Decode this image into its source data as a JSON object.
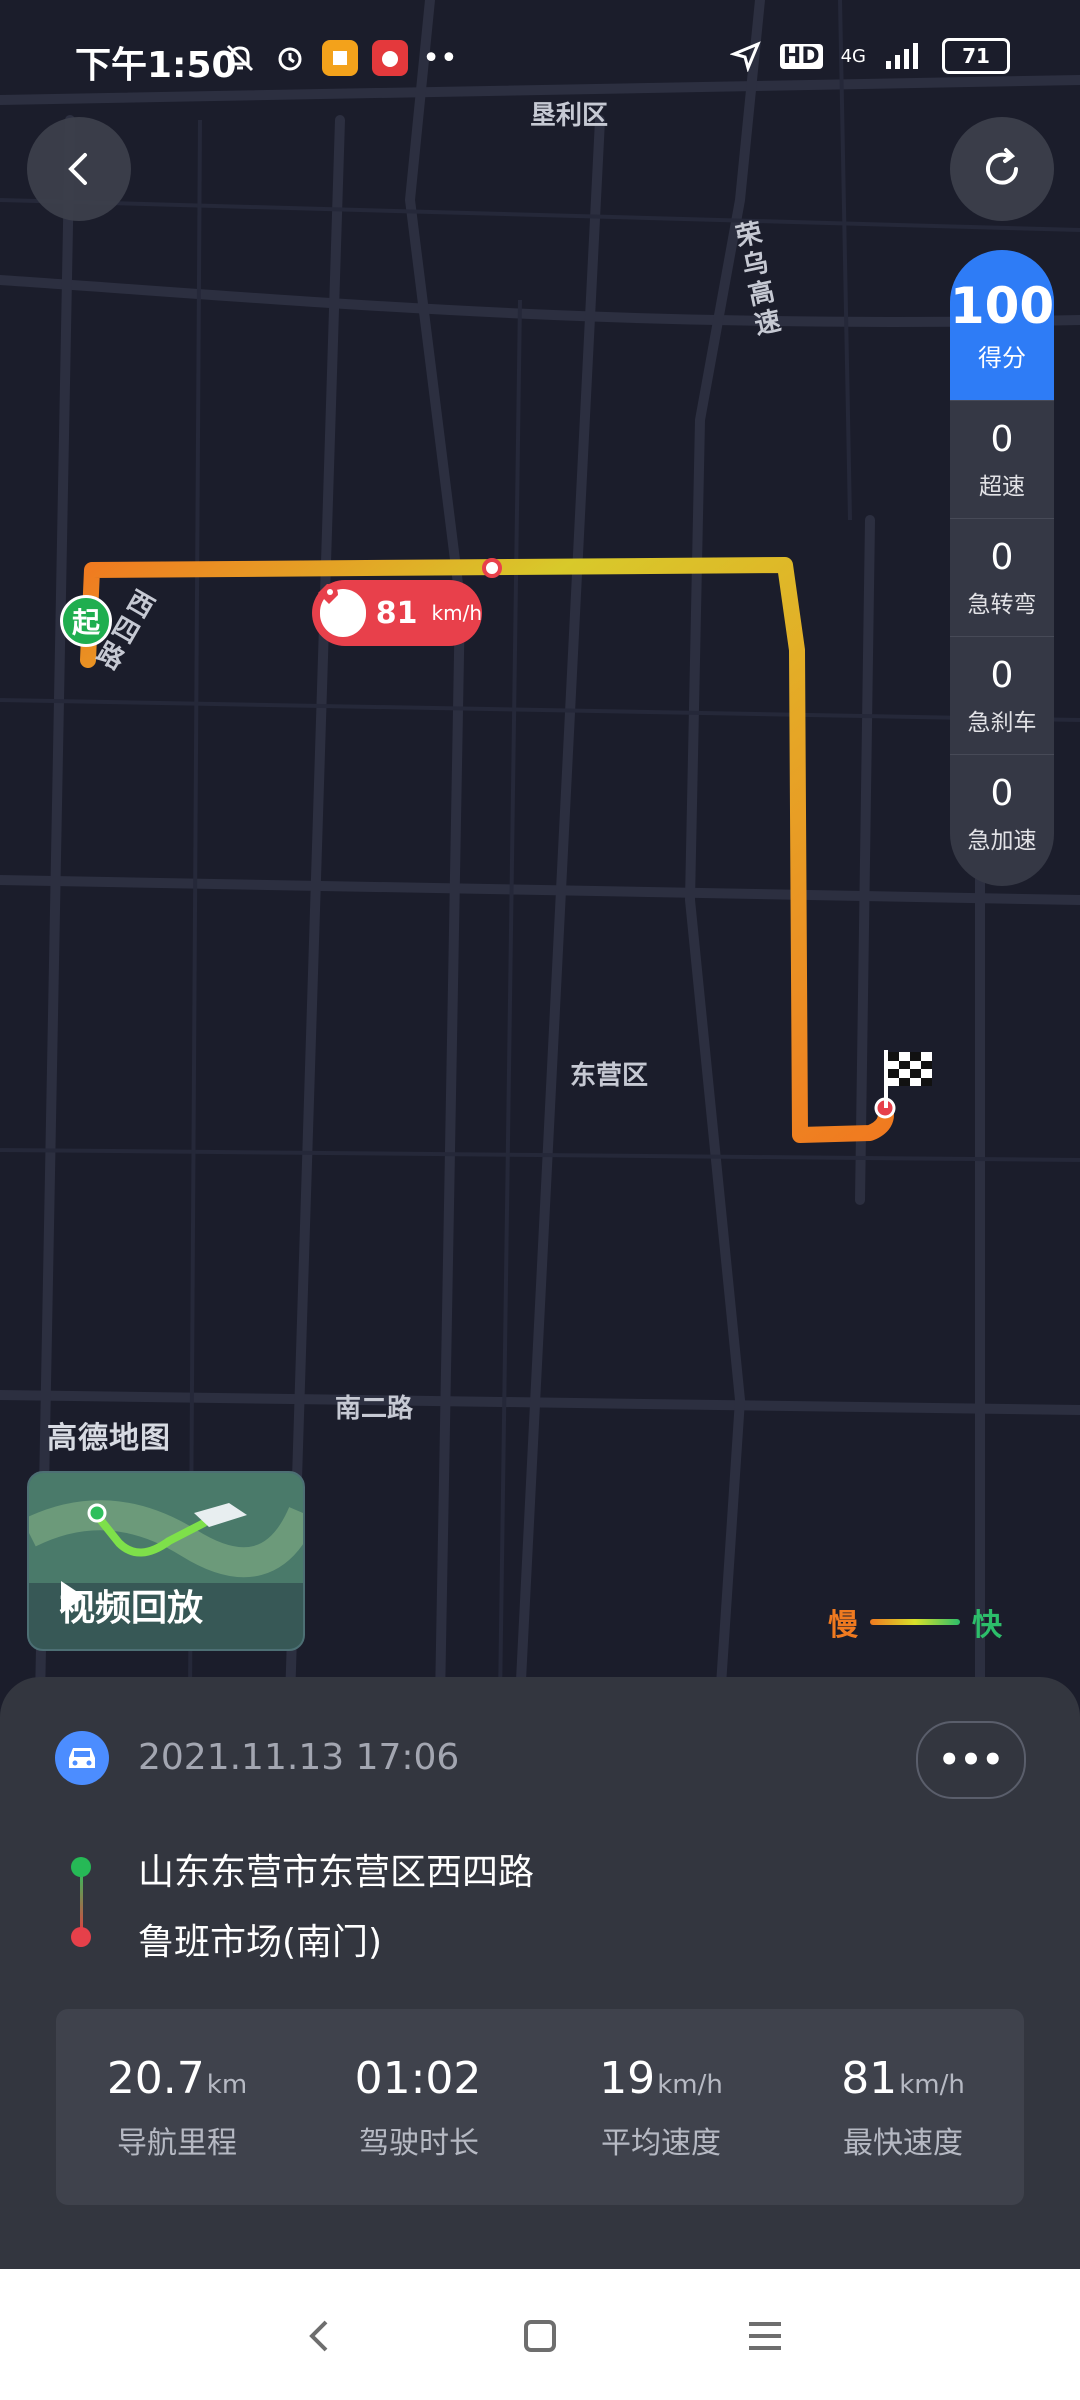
{
  "status_bar": {
    "time": "下午1:50",
    "network": "4G",
    "hd": "HD",
    "battery": "71"
  },
  "map": {
    "labels": {
      "kenli": "垦利区",
      "rongwu": "荣乌高速",
      "xisi": "西四路",
      "dongying": "东营区",
      "naner": "南二路"
    },
    "start_marker": "起",
    "top_speed_bubble": {
      "value": "81",
      "unit": "km/h"
    },
    "brand": "高德地图",
    "video_replay_label": "视频回放",
    "legend": {
      "slow": "慢",
      "fast": "快"
    }
  },
  "score_panel": {
    "score": "100",
    "score_label": "得分",
    "metrics": [
      {
        "value": "0",
        "label": "超速"
      },
      {
        "value": "0",
        "label": "急转弯"
      },
      {
        "value": "0",
        "label": "急刹车"
      },
      {
        "value": "0",
        "label": "急加速"
      }
    ]
  },
  "trip": {
    "datetime": "2021.11.13 17:06",
    "more": "•••",
    "start": "山东东营市东营区西四路",
    "end": "鲁班市场(南门)",
    "stats": [
      {
        "value": "20.7",
        "unit": "km",
        "label": "导航里程"
      },
      {
        "value": "01:02",
        "unit": "",
        "label": "驾驶时长"
      },
      {
        "value": "19",
        "unit": "km/h",
        "label": "平均速度"
      },
      {
        "value": "81",
        "unit": "km/h",
        "label": "最快速度"
      }
    ]
  },
  "colors": {
    "accent": "#2e7cf6",
    "route_slow": "#f07a20",
    "route_fast": "#d8e12a",
    "start": "#1fae4f",
    "end": "#e6404a"
  }
}
